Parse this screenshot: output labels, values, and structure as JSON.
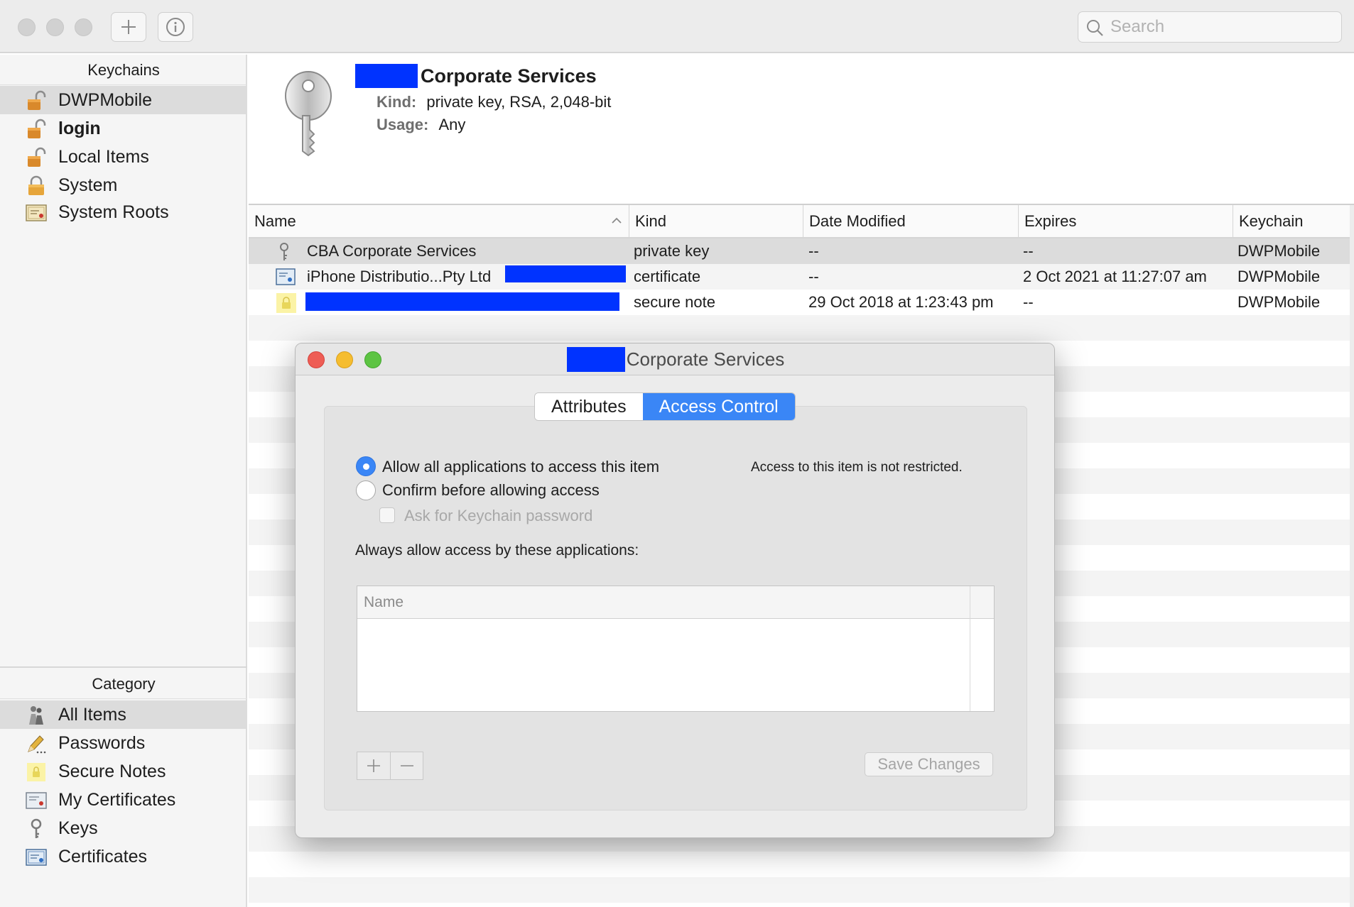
{
  "toolbar": {
    "add_icon": "plus-icon",
    "info_icon": "info-icon",
    "search_placeholder": "Search"
  },
  "sidebar": {
    "keychains_header": "Keychains",
    "keychains": [
      {
        "label": "DWPMobile",
        "icon": "lock-open-icon",
        "selected": true
      },
      {
        "label": "login",
        "icon": "lock-open-icon",
        "bold": true
      },
      {
        "label": "Local Items",
        "icon": "lock-open-icon"
      },
      {
        "label": "System",
        "icon": "lock-closed-icon"
      },
      {
        "label": "System Roots",
        "icon": "certificate-icon"
      }
    ],
    "category_header": "Category",
    "categories": [
      {
        "label": "All Items",
        "icon": "people-icon",
        "selected": true
      },
      {
        "label": "Passwords",
        "icon": "pencil-icon"
      },
      {
        "label": "Secure Notes",
        "icon": "note-icon"
      },
      {
        "label": "My Certificates",
        "icon": "my-certificate-icon"
      },
      {
        "label": "Keys",
        "icon": "key-icon"
      },
      {
        "label": "Certificates",
        "icon": "certificate-icon"
      }
    ]
  },
  "detail": {
    "title": "Corporate Services",
    "kind_label": "Kind:",
    "kind_value": "private key, RSA, 2,048-bit",
    "usage_label": "Usage:",
    "usage_value": "Any"
  },
  "table": {
    "columns": [
      "Name",
      "Kind",
      "Date Modified",
      "Expires",
      "Keychain"
    ],
    "rows": [
      {
        "name": "CBA Corporate Services",
        "kind": "private key",
        "date_modified": "--",
        "expires": "--",
        "keychain": "DWPMobile",
        "icon": "key-icon"
      },
      {
        "name": "iPhone Distributio...Pty Ltd",
        "kind": "certificate",
        "date_modified": "--",
        "expires": "2 Oct 2021 at 11:27:07 am",
        "keychain": "DWPMobile",
        "icon": "certificate-icon"
      },
      {
        "name": "",
        "kind": "secure note",
        "date_modified": "29 Oct 2018 at 1:23:43 pm",
        "expires": "--",
        "keychain": "DWPMobile",
        "icon": "note-icon"
      }
    ]
  },
  "dialog": {
    "title": "Corporate Services",
    "tabs": [
      "Attributes",
      "Access Control"
    ],
    "active_tab": "Access Control",
    "option_allow": "Allow all applications to access this item",
    "option_confirm": "Confirm before allowing access",
    "option_ask_password": "Ask for Keychain password",
    "status_text": "Access to this item is not restricted.",
    "always_allow_label": "Always allow access by these applications:",
    "list_column": "Name",
    "save_button": "Save Changes"
  },
  "colors": {
    "accent": "#3a86f6",
    "redaction": "#0033ff",
    "close": "#ee5d55",
    "minimize": "#f5bd30",
    "zoom": "#5dc443"
  }
}
